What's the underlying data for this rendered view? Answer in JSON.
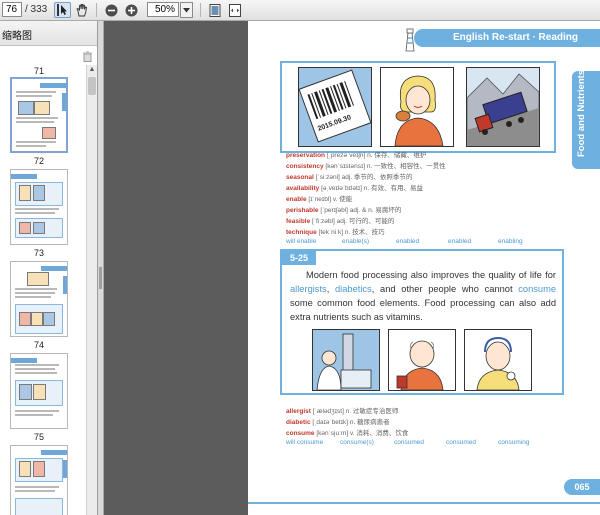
{
  "toolbar": {
    "page_value": "76",
    "page_total": "/ 333",
    "zoom_value": "50%"
  },
  "panel": {
    "title": "缩略图"
  },
  "thumbnails": [
    {
      "label": "71"
    },
    {
      "label": "72"
    },
    {
      "label": "73"
    },
    {
      "label": "74"
    },
    {
      "label": "75"
    }
  ],
  "page": {
    "header": "English Re-start · Reading",
    "side_tab": "Food and Nutrients",
    "stamp_text": "2015.09.30",
    "vocab1": [
      {
        "word": "preservation",
        "def": "[ˌprezəˈveɪʃn] n. 保存、储藏、维护"
      },
      {
        "word": "consistency",
        "def": "[kənˈsɪstənsɪ] n. 一致性、相容性、一贯性"
      },
      {
        "word": "seasonal",
        "def": "[ˈsiːzənl] adj. 季节的、依照季节的"
      },
      {
        "word": "availability",
        "def": "[əˌveɪləˈbɪlətɪ] n. 有效、有用、易益"
      },
      {
        "word": "enable",
        "def": "[ɪˈneɪbl] v. 使能"
      },
      {
        "word": "perishable",
        "def": "[ˈperɪʃəbl] adj. & n. 易腐坏的"
      },
      {
        "word": "feasible",
        "def": "[ˈfiːzəbl] adj. 可行的、可能的"
      },
      {
        "word": "technique",
        "def": "[tekˈniːk] n. 技术、技巧"
      }
    ],
    "options1": [
      "will enable",
      "enable(s)",
      "enabled",
      "enabled",
      "enabling"
    ],
    "passage_num": "5-25",
    "passage": {
      "p1": "Modern food processing also improves the quality of life for ",
      "w1": "allergists",
      "p2": ", ",
      "w2": "diabetics",
      "p3": ", and other people who cannot ",
      "w3": "consume",
      "p4": " some common food elements. Food processing can also add extra nutrients such as vitamins."
    },
    "vocab2": [
      {
        "word": "allergist",
        "def": "[ˈælədʒɪst] n. 过敏症专治医师"
      },
      {
        "word": "diabetic",
        "def": "[ˌdaɪəˈbetɪk] n. 糖尿病患者"
      },
      {
        "word": "consume",
        "def": "[kənˈsjuːm] v. 消耗、消费、饮食"
      }
    ],
    "options2": [
      "will consume",
      "consume(s)",
      "consumed",
      "consumed",
      "consuming"
    ],
    "page_number": "065"
  },
  "colors": {
    "accent": "#6eb0df",
    "vocab_word": "#c0392b",
    "option_text": "#4a9ad4"
  }
}
